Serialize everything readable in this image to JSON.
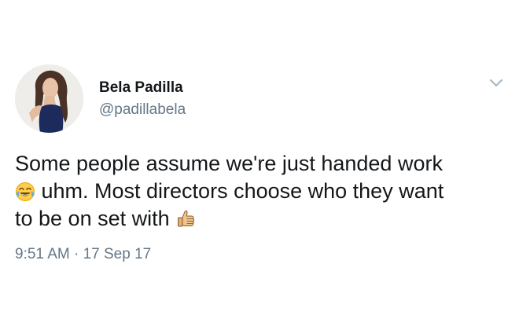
{
  "tweet": {
    "author": {
      "name": "Bela Padilla",
      "handle": "@padillabela"
    },
    "body": {
      "line1": "Some people assume we're just handed work",
      "line2": " uhm. Most directors choose who they want",
      "line3": "to be on set with ",
      "emoji_1": "face-with-tears-of-joy-emoji",
      "emoji_2": "thumbs-up-emoji"
    },
    "timestamp": "9:51 AM · 17 Sep 17",
    "menu_icon": "chevron-down-icon"
  },
  "colors": {
    "text": "#14171a",
    "secondary_text": "#657786",
    "caret": "#aab8c2",
    "background": "#ffffff"
  }
}
